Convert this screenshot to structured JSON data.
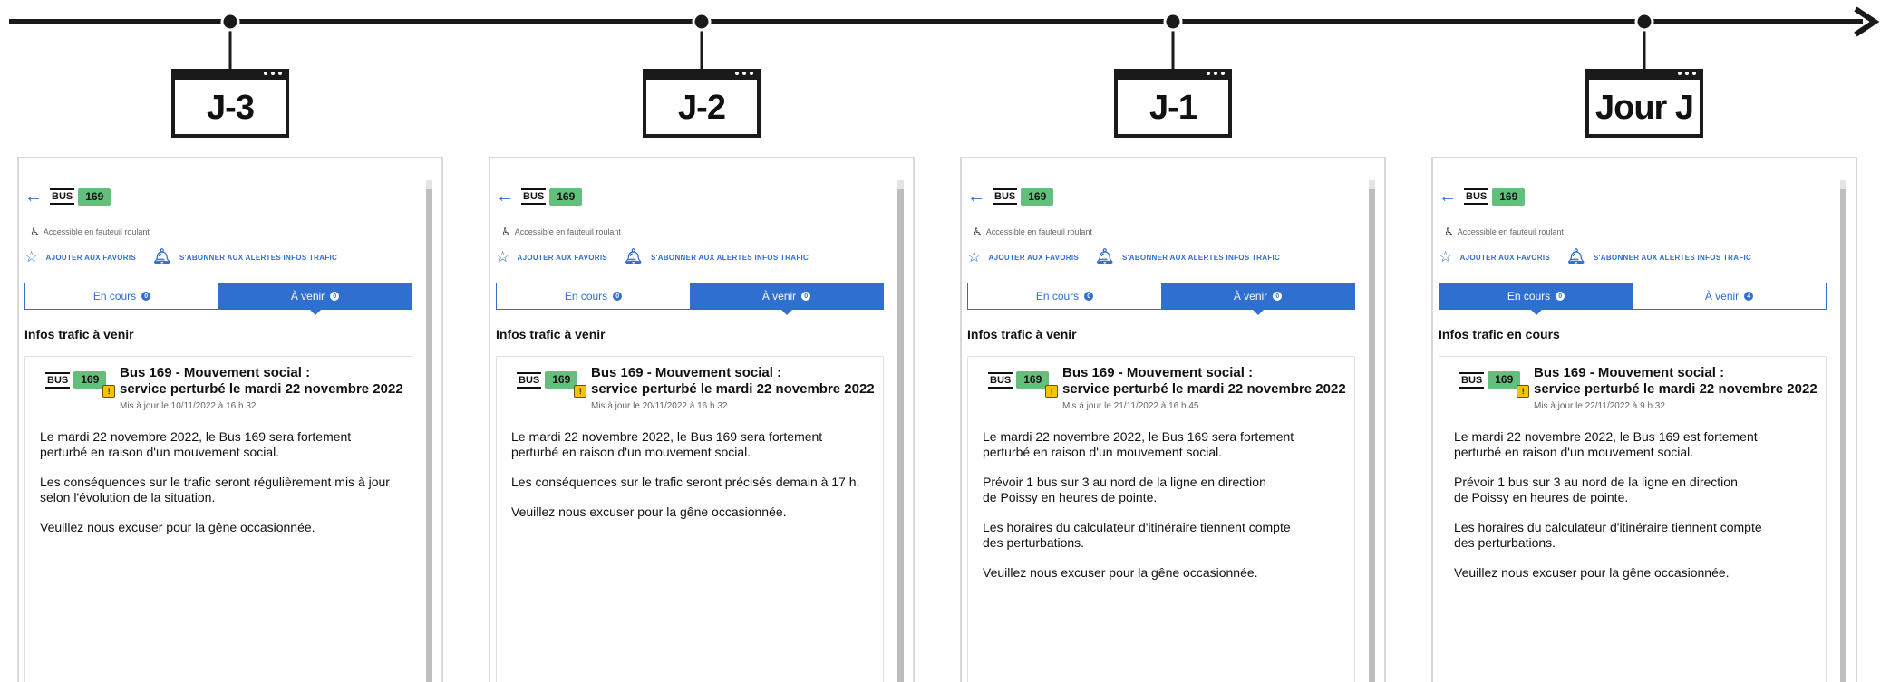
{
  "timeline": {
    "stages": [
      {
        "label": "J-3"
      },
      {
        "label": "J-2"
      },
      {
        "label": "J-1"
      },
      {
        "label": "Jour J"
      }
    ]
  },
  "panels": [
    {
      "bus_label": "BUS",
      "line_number": "169",
      "accessibility": "Accessible en fauteuil roulant",
      "favorite_label": "AJOUTER AUX FAVORIS",
      "subscribe_label": "S'ABONNER AUX ALERTES INFOS TRAFIC",
      "tab_current_label": "En cours",
      "tab_current_count": "0",
      "tab_upcoming_label": "À venir",
      "tab_upcoming_count": "0",
      "active_tab": "upcoming",
      "section_title": "Infos trafic à venir",
      "card_title": "Bus 169 - Mouvement social :\nservice perturbé le mardi 22 novembre 2022",
      "updated": "Mis à jour le 10/11/2022 à 16 h 32",
      "paragraphs": [
        "Le mardi 22 novembre 2022, le Bus 169 sera fortement\nperturbé en raison d'un mouvement social.",
        "Les conséquences sur le trafic seront régulièrement mis à jour\nselon l'évolution de la situation.",
        "Veuillez nous excuser pour la gêne occasionnée."
      ]
    },
    {
      "bus_label": "BUS",
      "line_number": "169",
      "accessibility": "Accessible en fauteuil roulant",
      "favorite_label": "AJOUTER AUX FAVORIS",
      "subscribe_label": "S'ABONNER AUX ALERTES INFOS TRAFIC",
      "tab_current_label": "En cours",
      "tab_current_count": "0",
      "tab_upcoming_label": "À venir",
      "tab_upcoming_count": "0",
      "active_tab": "upcoming",
      "section_title": "Infos trafic à venir",
      "card_title": "Bus 169 - Mouvement social :\nservice perturbé le mardi 22 novembre 2022",
      "updated": "Mis à jour le 20/11/2022 à 16 h 32",
      "paragraphs": [
        "Le mardi 22 novembre 2022, le Bus 169 sera fortement\nperturbé en raison d'un mouvement social.",
        "Les conséquences sur le trafic seront précisés demain à 17 h.",
        "Veuillez nous excuser pour la gêne occasionnée."
      ]
    },
    {
      "bus_label": "BUS",
      "line_number": "169",
      "accessibility": "Accessible en fauteuil roulant",
      "favorite_label": "AJOUTER AUX FAVORIS",
      "subscribe_label": "S'ABONNER AUX ALERTES INFOS TRAFIC",
      "tab_current_label": "En cours",
      "tab_current_count": "0",
      "tab_upcoming_label": "À venir",
      "tab_upcoming_count": "0",
      "active_tab": "upcoming",
      "section_title": "Infos trafic à venir",
      "card_title": "Bus 169 - Mouvement social :\nservice perturbé le mardi 22 novembre 2022",
      "updated": "Mis à jour le 21/11/2022 à 16 h 45",
      "paragraphs": [
        "Le mardi 22 novembre 2022, le Bus 169 sera fortement\nperturbé en raison d'un mouvement social.",
        "Prévoir 1 bus sur 3 au nord de la ligne en direction\nde Poissy en heures de pointe.",
        "Les horaires du calculateur d'itinéraire tiennent compte\ndes perturbations.",
        "Veuillez nous excuser pour la gêne occasionnée."
      ]
    },
    {
      "bus_label": "BUS",
      "line_number": "169",
      "accessibility": "Accessible en fauteuil roulant",
      "favorite_label": "AJOUTER AUX FAVORIS",
      "subscribe_label": "S'ABONNER AUX ALERTES INFOS TRAFIC",
      "tab_current_label": "En cours",
      "tab_current_count": "0",
      "tab_upcoming_label": "À venir",
      "tab_upcoming_count": "4",
      "active_tab": "current",
      "section_title": "Infos trafic en cours",
      "card_title": "Bus 169 - Mouvement social :\nservice perturbé le mardi 22 novembre 2022",
      "updated": "Mis à jour le 22/11/2022 à 9 h 32",
      "paragraphs": [
        "Le mardi 22 novembre 2022, le Bus 169 est fortement\nperturbé en raison d'un mouvement social.",
        "Prévoir 1 bus sur 3 au nord de la ligne en direction\nde Poissy en heures de pointe.",
        "Les horaires du calculateur d'itinéraire tiennent compte\ndes perturbations.",
        "Veuillez nous excuser pour la gêne occasionnée."
      ]
    }
  ],
  "icons": {
    "back": "arrow-left-icon",
    "wheelchair": "wheelchair-icon",
    "favorite": "star-icon",
    "subscribe": "bell-icon",
    "warning": "warning-icon"
  },
  "colors": {
    "accent": "#2f6fd0",
    "line_badge": "#63bf7b",
    "warning": "#f5c400",
    "timeline": "#1a1a1a"
  }
}
